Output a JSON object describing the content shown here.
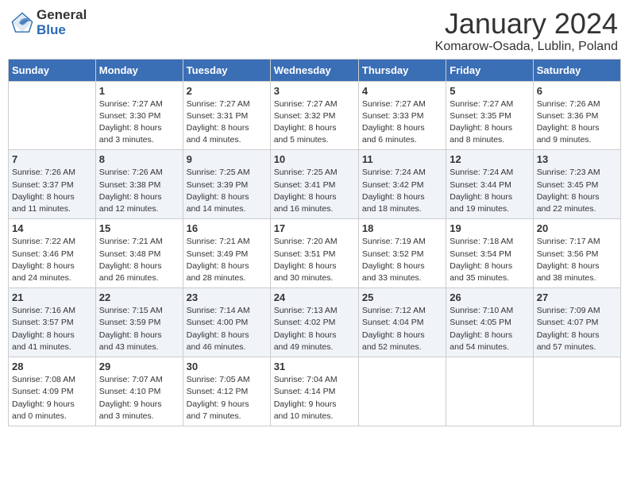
{
  "header": {
    "logo_general": "General",
    "logo_blue": "Blue",
    "month_title": "January 2024",
    "location": "Komarow-Osada, Lublin, Poland"
  },
  "days_of_week": [
    "Sunday",
    "Monday",
    "Tuesday",
    "Wednesday",
    "Thursday",
    "Friday",
    "Saturday"
  ],
  "weeks": [
    [
      {
        "day": "",
        "info": ""
      },
      {
        "day": "1",
        "info": "Sunrise: 7:27 AM\nSunset: 3:30 PM\nDaylight: 8 hours\nand 3 minutes."
      },
      {
        "day": "2",
        "info": "Sunrise: 7:27 AM\nSunset: 3:31 PM\nDaylight: 8 hours\nand 4 minutes."
      },
      {
        "day": "3",
        "info": "Sunrise: 7:27 AM\nSunset: 3:32 PM\nDaylight: 8 hours\nand 5 minutes."
      },
      {
        "day": "4",
        "info": "Sunrise: 7:27 AM\nSunset: 3:33 PM\nDaylight: 8 hours\nand 6 minutes."
      },
      {
        "day": "5",
        "info": "Sunrise: 7:27 AM\nSunset: 3:35 PM\nDaylight: 8 hours\nand 8 minutes."
      },
      {
        "day": "6",
        "info": "Sunrise: 7:26 AM\nSunset: 3:36 PM\nDaylight: 8 hours\nand 9 minutes."
      }
    ],
    [
      {
        "day": "7",
        "info": "Sunrise: 7:26 AM\nSunset: 3:37 PM\nDaylight: 8 hours\nand 11 minutes."
      },
      {
        "day": "8",
        "info": "Sunrise: 7:26 AM\nSunset: 3:38 PM\nDaylight: 8 hours\nand 12 minutes."
      },
      {
        "day": "9",
        "info": "Sunrise: 7:25 AM\nSunset: 3:39 PM\nDaylight: 8 hours\nand 14 minutes."
      },
      {
        "day": "10",
        "info": "Sunrise: 7:25 AM\nSunset: 3:41 PM\nDaylight: 8 hours\nand 16 minutes."
      },
      {
        "day": "11",
        "info": "Sunrise: 7:24 AM\nSunset: 3:42 PM\nDaylight: 8 hours\nand 18 minutes."
      },
      {
        "day": "12",
        "info": "Sunrise: 7:24 AM\nSunset: 3:44 PM\nDaylight: 8 hours\nand 19 minutes."
      },
      {
        "day": "13",
        "info": "Sunrise: 7:23 AM\nSunset: 3:45 PM\nDaylight: 8 hours\nand 22 minutes."
      }
    ],
    [
      {
        "day": "14",
        "info": "Sunrise: 7:22 AM\nSunset: 3:46 PM\nDaylight: 8 hours\nand 24 minutes."
      },
      {
        "day": "15",
        "info": "Sunrise: 7:21 AM\nSunset: 3:48 PM\nDaylight: 8 hours\nand 26 minutes."
      },
      {
        "day": "16",
        "info": "Sunrise: 7:21 AM\nSunset: 3:49 PM\nDaylight: 8 hours\nand 28 minutes."
      },
      {
        "day": "17",
        "info": "Sunrise: 7:20 AM\nSunset: 3:51 PM\nDaylight: 8 hours\nand 30 minutes."
      },
      {
        "day": "18",
        "info": "Sunrise: 7:19 AM\nSunset: 3:52 PM\nDaylight: 8 hours\nand 33 minutes."
      },
      {
        "day": "19",
        "info": "Sunrise: 7:18 AM\nSunset: 3:54 PM\nDaylight: 8 hours\nand 35 minutes."
      },
      {
        "day": "20",
        "info": "Sunrise: 7:17 AM\nSunset: 3:56 PM\nDaylight: 8 hours\nand 38 minutes."
      }
    ],
    [
      {
        "day": "21",
        "info": "Sunrise: 7:16 AM\nSunset: 3:57 PM\nDaylight: 8 hours\nand 41 minutes."
      },
      {
        "day": "22",
        "info": "Sunrise: 7:15 AM\nSunset: 3:59 PM\nDaylight: 8 hours\nand 43 minutes."
      },
      {
        "day": "23",
        "info": "Sunrise: 7:14 AM\nSunset: 4:00 PM\nDaylight: 8 hours\nand 46 minutes."
      },
      {
        "day": "24",
        "info": "Sunrise: 7:13 AM\nSunset: 4:02 PM\nDaylight: 8 hours\nand 49 minutes."
      },
      {
        "day": "25",
        "info": "Sunrise: 7:12 AM\nSunset: 4:04 PM\nDaylight: 8 hours\nand 52 minutes."
      },
      {
        "day": "26",
        "info": "Sunrise: 7:10 AM\nSunset: 4:05 PM\nDaylight: 8 hours\nand 54 minutes."
      },
      {
        "day": "27",
        "info": "Sunrise: 7:09 AM\nSunset: 4:07 PM\nDaylight: 8 hours\nand 57 minutes."
      }
    ],
    [
      {
        "day": "28",
        "info": "Sunrise: 7:08 AM\nSunset: 4:09 PM\nDaylight: 9 hours\nand 0 minutes."
      },
      {
        "day": "29",
        "info": "Sunrise: 7:07 AM\nSunset: 4:10 PM\nDaylight: 9 hours\nand 3 minutes."
      },
      {
        "day": "30",
        "info": "Sunrise: 7:05 AM\nSunset: 4:12 PM\nDaylight: 9 hours\nand 7 minutes."
      },
      {
        "day": "31",
        "info": "Sunrise: 7:04 AM\nSunset: 4:14 PM\nDaylight: 9 hours\nand 10 minutes."
      },
      {
        "day": "",
        "info": ""
      },
      {
        "day": "",
        "info": ""
      },
      {
        "day": "",
        "info": ""
      }
    ]
  ]
}
